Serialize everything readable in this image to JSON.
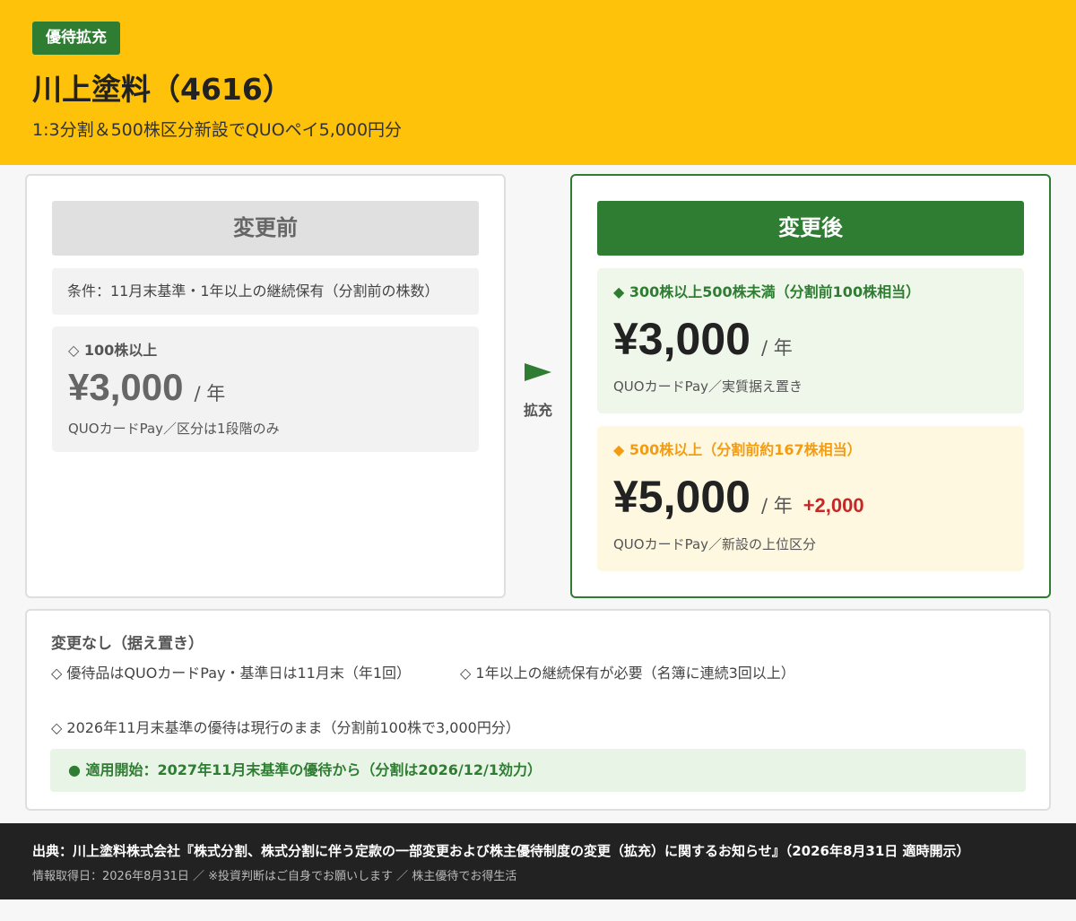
{
  "header": {
    "badge": "優待拡充",
    "title": "川上塗料（4616）",
    "subtitle": "1:3分割＆500株区分新設でQUOペイ5,000円分",
    "background_color": "#fec20a"
  },
  "before": {
    "heading": "変更前",
    "condition": "条件：11月末基準・1年以上の継続保有（分割前の株数）",
    "tier": {
      "label": "◇ 100株以上",
      "price": "¥3,000",
      "unit": "/ 年",
      "note": "QUOカードPay／区分は1段階のみ"
    }
  },
  "arrow": {
    "icon": "arrow-right-icon",
    "label": "拡充"
  },
  "after": {
    "heading": "変更後",
    "accent_color": "#2e7d32",
    "tiers": [
      {
        "label": "◆ 300株以上500株未満（分割前100株相当）",
        "price": "¥3,000",
        "unit": "/ 年",
        "note": "QUOカードPay／実質据え置き",
        "color": "#2e7d32"
      },
      {
        "label": "◆ 500株以上（分割前約167株相当）",
        "price": "¥5,000",
        "unit": "/ 年",
        "increase": "+2,000",
        "note": "QUOカードPay／新設の上位区分",
        "color": "#f39c12"
      }
    ]
  },
  "unchanged": {
    "title": "変更なし（据え置き）",
    "items": [
      "◇ 優待品はQUOカードPay・基準日は11月末（年1回）",
      "◇ 1年以上の継続保有が必要（名簿に連続3回以上）",
      "◇ 2026年11月末基準の優待は現行のまま（分割前100株で3,000円分）"
    ],
    "apply": "● 適用開始：2027年11月末基準の優待から（分割は2026/12/1効力）"
  },
  "footer": {
    "source": "出典：川上塗料株式会社『株式分割、株式分割に伴う定款の一部変更および株主優待制度の変更（拡充）に関するお知らせ』（2026年8月31日 適時開示）",
    "info": "情報取得日：2026年8月31日 ／ ※投資判断はご自身でお願いします ／ 株主優待でお得生活"
  }
}
